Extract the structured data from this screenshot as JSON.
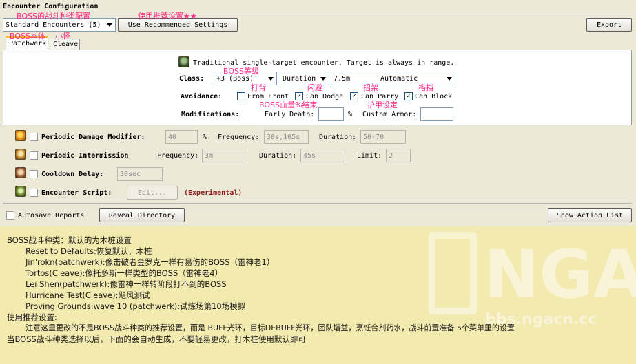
{
  "window": {
    "title": "Encounter Configuration"
  },
  "toolbar": {
    "encounter_select": "Standard Encounters (5)",
    "recommended_button": "Use Recommended Settings",
    "export_button": "Export"
  },
  "tabs": [
    {
      "label": "Patchwerk",
      "active": true
    },
    {
      "label": "Cleave",
      "active": false
    }
  ],
  "description": "Traditional single-target encounter.  Target is always in range.",
  "class_row": {
    "label": "Class:",
    "class_value": "+3 (Boss)",
    "duration_select": "Duration",
    "duration_value": "7.5m",
    "mode_select": "Automatic"
  },
  "avoidance": {
    "label": "Avoidance:",
    "options": [
      {
        "label": "From Front",
        "checked": false
      },
      {
        "label": "Can Dodge",
        "checked": true
      },
      {
        "label": "Can Parry",
        "checked": true
      },
      {
        "label": "Can Block",
        "checked": true
      }
    ]
  },
  "modifications": {
    "label": "Modifications:",
    "early_death_label": "Early Death:",
    "early_death_value": "",
    "percent": "%",
    "custom_armor_label": "Custom Armor:",
    "custom_armor_value": ""
  },
  "periodic_damage": {
    "label": "Periodic Damage Modifier:",
    "value": "40",
    "percent": "%",
    "frequency_label": "Frequency:",
    "frequency_value": "30s,105s",
    "duration_label": "Duration:",
    "duration_value": "50-70"
  },
  "periodic_intermission": {
    "label": "Periodic Intermission",
    "frequency_label": "Frequency:",
    "frequency_value": "3m",
    "duration_label": "Duration:",
    "duration_value": "45s",
    "limit_label": "Limit:",
    "limit_value": "2"
  },
  "cooldown_delay": {
    "label": "Cooldown Delay:",
    "value": "30sec"
  },
  "encounter_script": {
    "label": "Encounter Script:",
    "button": "Edit...",
    "note": "(Experimental)"
  },
  "bottom": {
    "autosave_label": "Autosave Reports",
    "reveal_button": "Reveal Directory",
    "action_list_button": "Show Action List"
  },
  "annotations": {
    "boss_type": "BOSS的战斗种类配置",
    "recommended": "使用推荐设置★★",
    "boss_body": "BOSS本体",
    "minion": "小怪",
    "boss_level": "BOSS等级",
    "hit": "打背",
    "dodge": "闪避",
    "parry": "招架",
    "block": "格挡",
    "blood_end": "BOSS血量%结束",
    "armor": "护甲设定"
  },
  "notes": [
    "BOSS战斗种类：默认的为木桩设置",
    "Reset to Defaults:恢复默认，木桩",
    "Jin'rokn(patchwerk):像击破者金罗克一样有易伤的BOSS（雷神老1）",
    "Tortos(Cleave):像托多斯一样类型的BOSS（雷神老4）",
    "Lei Shen(patchwerk):像雷神一样转阶段打不到的BOSS",
    "Hurricane Test(Cleave):飓风测试",
    "Proving Grounds:wave 10 (patchwerk):试炼场第10场模拟",
    "使用推荐设置:",
    "注意这里更改的不是BOSS战斗种类的推荐设置，而是 BUFF光环，目标DEBUFF光环，团队增益，烹饪合剂药水，战斗前置准备 5个菜单里的设置",
    "当BOSS战斗种类选择以后，下面的会自动生成，不要轻易更改，打木桩使用默认即可"
  ],
  "watermark": {
    "big": "NGA",
    "small": "bbs.ngacn.cc"
  },
  "colors": {
    "background": "#ece9d8",
    "note_bg": "#f3eab0",
    "annotation": "#ff2b86",
    "experimental": "#8b1a1a"
  }
}
